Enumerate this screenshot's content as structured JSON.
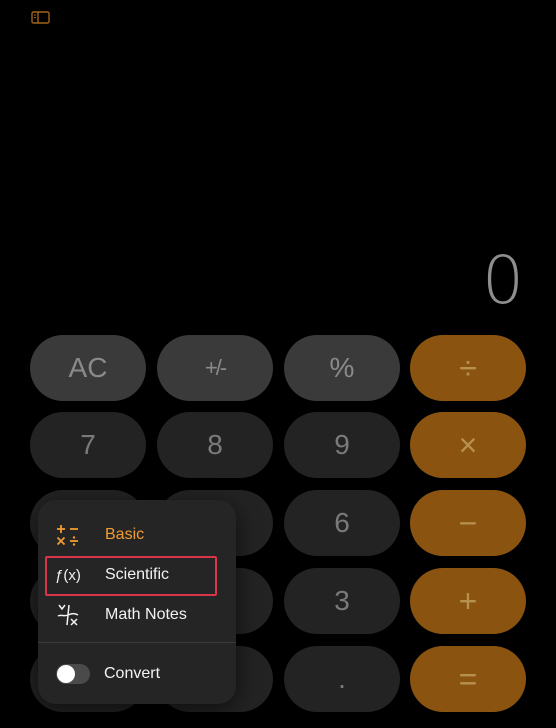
{
  "display": {
    "value": "0"
  },
  "keys": {
    "ac": "AC",
    "sign": "+/-",
    "percent": "%",
    "divide": "÷",
    "seven": "7",
    "eight": "8",
    "nine": "9",
    "multiply": "×",
    "six": "6",
    "minus": "−",
    "three": "3",
    "plus": "+",
    "decimal": ".",
    "equals": "="
  },
  "menu": {
    "basic_label": "Basic",
    "scientific_label": "Scientific",
    "scientific_icon_text": "ƒ(x)",
    "notes_label": "Math Notes",
    "convert_label": "Convert",
    "convert_on": false
  },
  "colors": {
    "accent": "#f29b34",
    "operator_key": "#8a5410",
    "highlight": "#d9344a"
  }
}
